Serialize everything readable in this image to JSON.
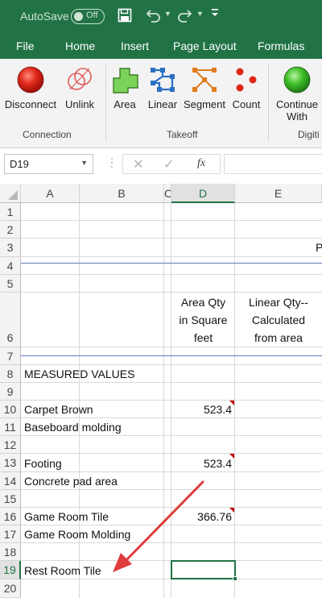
{
  "titlebar": {
    "autosave_label": "AutoSave",
    "autosave_state": "Off"
  },
  "tabs": [
    "File",
    "Home",
    "Insert",
    "Page Layout",
    "Formulas"
  ],
  "ribbon": {
    "buttons": {
      "disconnect": "Disconnect",
      "unlink": "Unlink",
      "area": "Area",
      "linear": "Linear",
      "segment": "Segment",
      "count": "Count",
      "continue_line1": "Continue",
      "continue_line2": "With"
    },
    "groups": {
      "connection": "Connection",
      "takeoff": "Takeoff",
      "digiti": "Digiti"
    }
  },
  "formula_bar": {
    "name_box": "D19",
    "fx": "fx",
    "cancel": "✕",
    "enter": "✓",
    "formula": ""
  },
  "columns": [
    "A",
    "B",
    "C",
    "D",
    "E"
  ],
  "rows": [
    "1",
    "2",
    "3",
    "4",
    "5",
    "6",
    "7",
    "8",
    "9",
    "10",
    "11",
    "12",
    "13",
    "14",
    "15",
    "16",
    "17",
    "18",
    "19",
    "20"
  ],
  "cells": {
    "r3_e": "P",
    "d6_l1": "Area Qty",
    "d6_l2": "in Square",
    "d6_l3": "feet",
    "e6_l1": "Linear Qty--",
    "e6_l2": "Calculated",
    "e6_l3": "from area",
    "a8": "MEASURED VALUES",
    "a10": "Carpet Brown",
    "d10": "523.4",
    "a11": "Baseboard molding",
    "a13": "Footing",
    "d13": "523.4",
    "a14": "Concrete pad area",
    "a16": "Game Room Tile",
    "d16": "366.76",
    "a17": "Game Room Molding",
    "a19": "Rest Room Tile"
  },
  "colors": {
    "excel_green": "#217346",
    "selection": "#217346",
    "annotation_arrow": "#e03c3c",
    "comment_marker": "#c00000"
  }
}
